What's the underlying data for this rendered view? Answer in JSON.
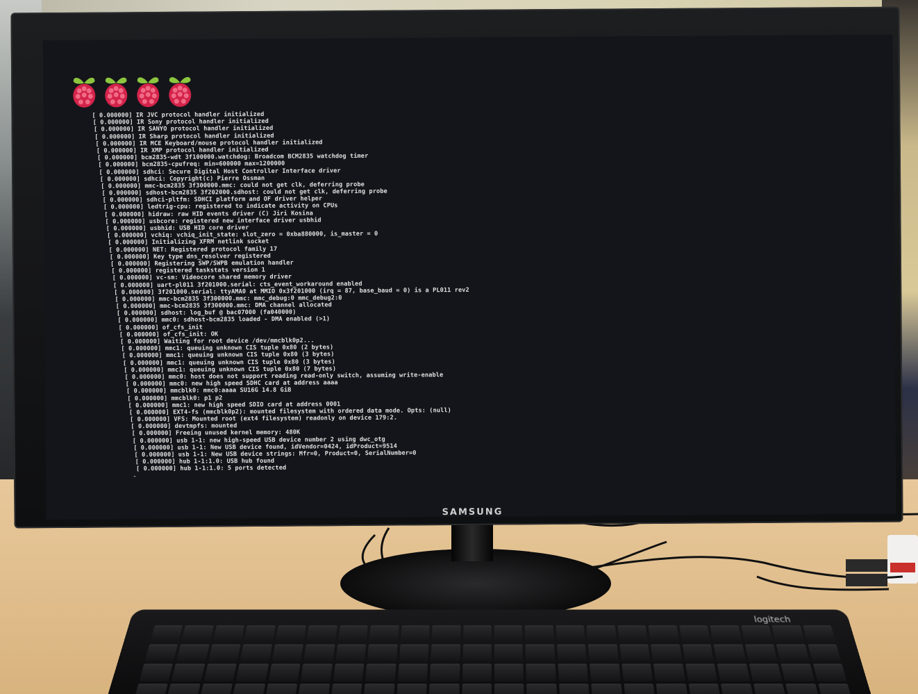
{
  "monitor": {
    "brand": "SAMSUNG",
    "boot_logo": {
      "count": 4,
      "icon": "raspberry-pi-logo-icon",
      "leaf_color": "#8cc63f",
      "berry_color": "#d4234a"
    },
    "console_lines": [
      "[    0.000000] IR JVC protocol handler initialized",
      "[    0.000000] IR Sony protocol handler initialized",
      "[    0.000000] IR SANYO protocol handler initialized",
      "[    0.000000] IR Sharp protocol handler initialized",
      "[    0.000000] IR MCE Keyboard/mouse protocol handler initialized",
      "[    0.000000] IR XMP protocol handler initialized",
      "[    0.000000] bcm2835-wdt 3f100000.watchdog: Broadcom BCM2835 watchdog timer",
      "[    0.000000] bcm2835-cpufreq: min=600000 max=1200000",
      "[    0.000000] sdhci: Secure Digital Host Controller Interface driver",
      "[    0.000000] sdhci: Copyright(c) Pierre Ossman",
      "[    0.000000] mmc-bcm2835 3f300000.mmc: could not get clk, deferring probe",
      "[    0.000000] sdhost-bcm2835 3f202000.sdhost: could not get clk, deferring probe",
      "[    0.000000] sdhci-pltfm: SDHCI platform and OF driver helper",
      "[    0.000000] ledtrig-cpu: registered to indicate activity on CPUs",
      "[    0.000000] hidraw: raw HID events driver (C) Jiri Kosina",
      "[    0.000000] usbcore: registered new interface driver usbhid",
      "[    0.000000] usbhid: USB HID core driver",
      "[    0.000000] vchiq: vchiq_init_state: slot_zero = 0xba880000, is_master = 0",
      "[    0.000000] Initializing XFRM netlink socket",
      "[    0.000000] NET: Registered protocol family 17",
      "[    0.000000] Key type dns_resolver registered",
      "[    0.000000] Registering SWP/SWPB emulation handler",
      "[    0.000000] registered taskstats version 1",
      "[    0.000000] vc-sm: Videocore shared memory driver",
      "[    0.000000] uart-pl011 3f201000.serial: cts_event_workaround enabled",
      "[    0.000000] 3f201000.serial: ttyAMA0 at MMIO 0x3f201000 (irq = 87, base_baud = 0) is a PL011 rev2",
      "[    0.000000] mmc-bcm2835 3f300000.mmc: mmc_debug:0 mmc_debug2:0",
      "[    0.000000] mmc-bcm2835 3f300000.mmc: DMA channel allocated",
      "[    0.000000] sdhost: log_buf @ bac07000 (fa040000)",
      "[    0.000000] mmc0: sdhost-bcm2835 loaded - DMA enabled (>1)",
      "[    0.000000] of_cfs_init",
      "[    0.000000] of_cfs_init: OK",
      "[    0.000000] Waiting for root device /dev/mmcblk0p2...",
      "[    0.000000] mmc1: queuing unknown CIS tuple 0x80 (2 bytes)",
      "[    0.000000] mmc1: queuing unknown CIS tuple 0x80 (3 bytes)",
      "[    0.000000] mmc1: queuing unknown CIS tuple 0x80 (3 bytes)",
      "[    0.000000] mmc1: queuing unknown CIS tuple 0x80 (7 bytes)",
      "[    0.000000] mmc0: host does not support reading read-only switch, assuming write-enable",
      "[    0.000000] mmc0: new high speed SDHC card at address aaaa",
      "[    0.000000] mmcblk0: mmc0:aaaa SU16G 14.8 GiB",
      "[    0.000000]  mmcblk0: p1 p2",
      "[    0.000000] mmc1: new high speed SDIO card at address 0001",
      "[    0.000000] EXT4-fs (mmcblk0p2): mounted filesystem with ordered data mode. Opts: (null)",
      "[    0.000000] VFS: Mounted root (ext4 filesystem) readonly on device 179:2.",
      "[    0.000000] devtmpfs: mounted",
      "[    0.000000] Freeing unused kernel memory: 480K",
      "[    0.000000] usb 1-1: new high-speed USB device number 2 using dwc_otg",
      "[    0.000000] usb 1-1: New USB device found, idVendor=0424, idProduct=9514",
      "[    0.000000] usb 1-1: New USB device strings: Mfr=0, Product=0, SerialNumber=0",
      "[    0.000000] hub 1-1:1.0: USB hub found",
      "[    0.000000] hub 1-1:1.0: 5 ports detected"
    ],
    "cursor": "-"
  },
  "keyboard": {
    "brand": "logitech"
  },
  "colors": {
    "screen_bg": "#14151a",
    "text": "#f2f2f2",
    "desk": "#e2c090",
    "bezel": "#0e0f10"
  }
}
